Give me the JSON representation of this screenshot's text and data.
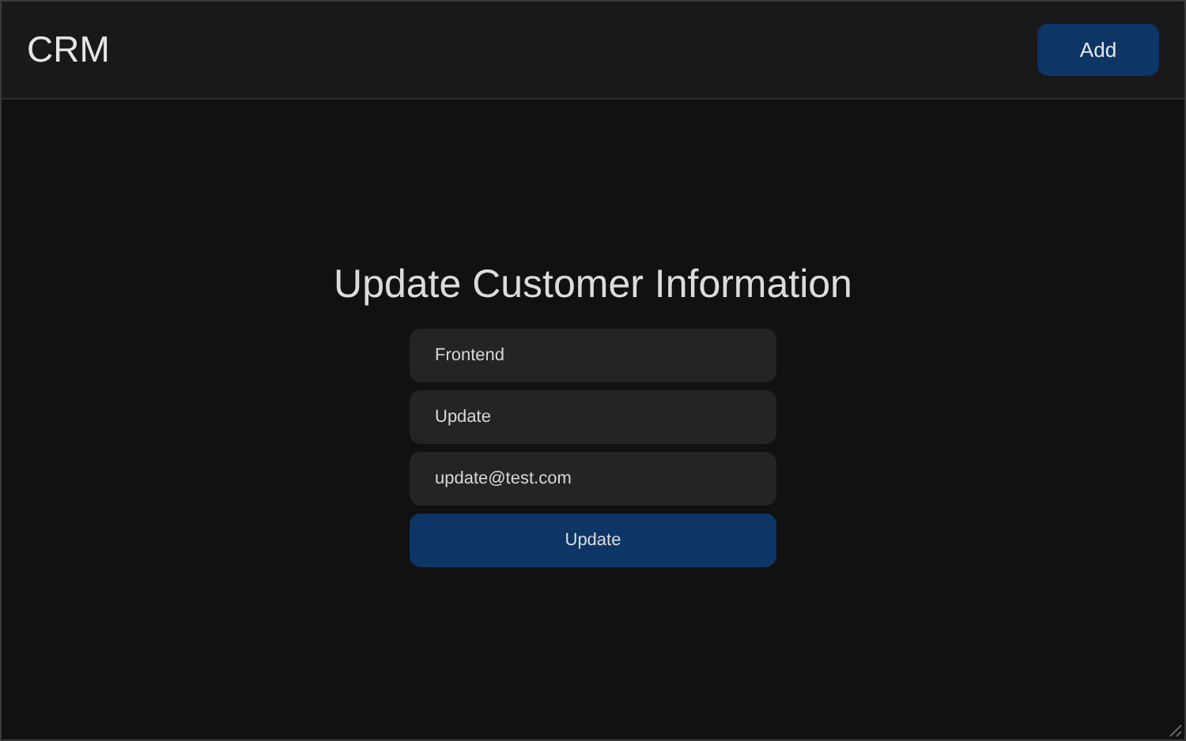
{
  "header": {
    "title": "CRM",
    "add_button": "Add"
  },
  "form": {
    "title": "Update Customer Information",
    "fields": [
      {
        "value": "Frontend"
      },
      {
        "value": "Update"
      },
      {
        "value": "update@test.com"
      }
    ],
    "submit": "Update"
  }
}
